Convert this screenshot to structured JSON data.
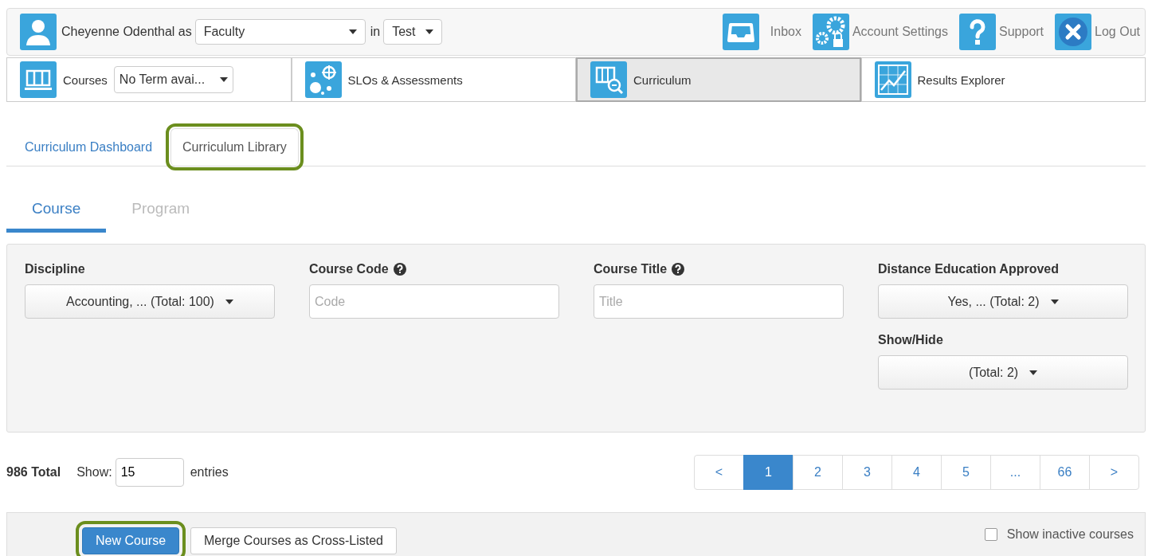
{
  "header": {
    "user_label": "Cheyenne Odenthal as",
    "role_select": "Faculty",
    "in_label": "in",
    "term_select": "Test",
    "actions": [
      {
        "label": "Inbox",
        "kind": "inbox"
      },
      {
        "label": "Account Settings",
        "kind": "settings"
      },
      {
        "label": "Support",
        "kind": "support"
      },
      {
        "label": "Log Out",
        "kind": "logout"
      }
    ]
  },
  "modules": [
    {
      "label": "Courses",
      "kind": "courses",
      "selected": false,
      "select": "No Term avai..."
    },
    {
      "label": "SLOs & Assessments",
      "kind": "slos",
      "selected": false
    },
    {
      "label": "Curriculum",
      "kind": "curriculum",
      "selected": true
    },
    {
      "label": "Results Explorer",
      "kind": "results",
      "selected": false
    }
  ],
  "sub_tabs": [
    {
      "label": "Curriculum Dashboard",
      "selected": false,
      "highlighted": false
    },
    {
      "label": "Curriculum Library",
      "selected": true,
      "highlighted": true
    }
  ],
  "type_tabs": [
    {
      "label": "Course",
      "selected": true
    },
    {
      "label": "Program",
      "selected": false
    }
  ],
  "filters": [
    {
      "label": "Discipline",
      "kind": "dropdown",
      "help": false,
      "value": "Accounting, ... (Total: 100)"
    },
    {
      "label": "Course Code",
      "kind": "text",
      "help": true,
      "placeholder": "Code"
    },
    {
      "label": "Course Title",
      "kind": "text",
      "help": true,
      "placeholder": "Title"
    },
    {
      "label": "Distance Education Approved",
      "kind": "dropdown",
      "help": false,
      "value": "Yes, ... (Total: 2)"
    },
    {
      "label": "Show/Hide",
      "kind": "dropdown",
      "help": false,
      "value": "(Total: 2)"
    }
  ],
  "summary": {
    "total": "986 Total",
    "show_label": "Show:",
    "entries_value": "15",
    "entries_label": "entries"
  },
  "pagination": [
    {
      "label": "<",
      "selected": false
    },
    {
      "label": "1",
      "selected": true
    },
    {
      "label": "2",
      "selected": false
    },
    {
      "label": "3",
      "selected": false
    },
    {
      "label": "4",
      "selected": false
    },
    {
      "label": "5",
      "selected": false
    },
    {
      "label": "...",
      "selected": false
    },
    {
      "label": "66",
      "selected": false
    },
    {
      "label": ">",
      "selected": false
    }
  ],
  "toolbar": {
    "buttons": [
      {
        "label": "New Course",
        "kind": "primary",
        "highlighted": true
      },
      {
        "label": "Merge Courses as Cross-Listed",
        "kind": "default",
        "highlighted": false
      }
    ],
    "checkbox": {
      "label": "Show inactive courses",
      "checked": false
    }
  }
}
